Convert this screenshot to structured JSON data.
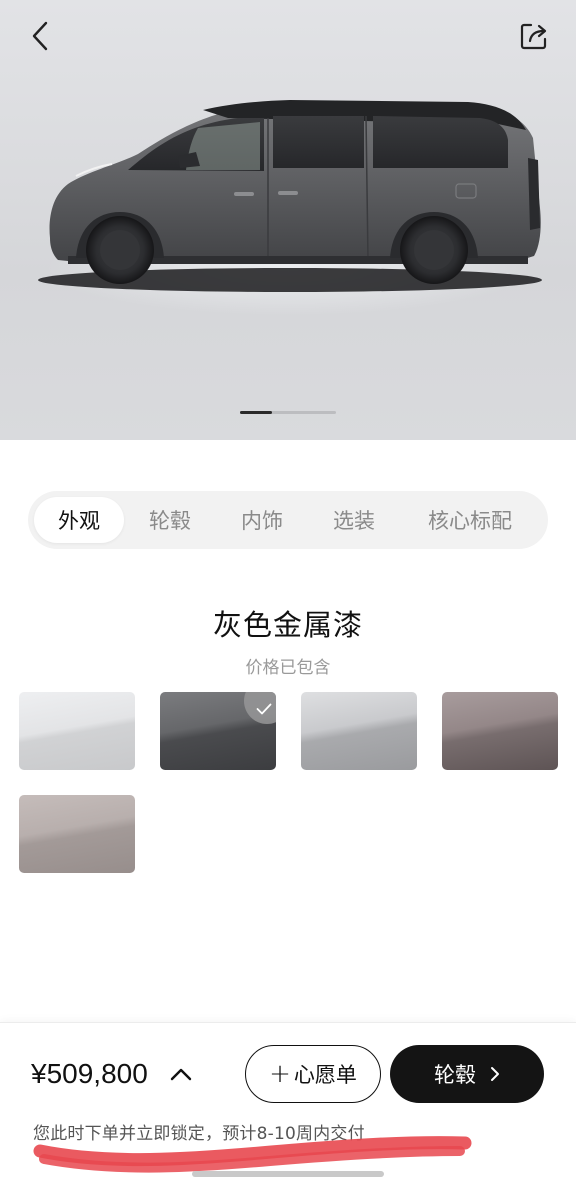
{
  "header": {
    "back_icon": "chevron-left-icon",
    "share_icon": "share-icon"
  },
  "gallery": {
    "current_page": 1,
    "total_pages": 3
  },
  "tabs": [
    {
      "label": "外观",
      "active": true
    },
    {
      "label": "轮毂",
      "active": false
    },
    {
      "label": "内饰",
      "active": false
    },
    {
      "label": "选装",
      "active": false
    },
    {
      "label": "核心标配",
      "active": false
    }
  ],
  "color_section": {
    "selected_name": "灰色金属漆",
    "price_note": "价格已包含",
    "swatches": [
      {
        "color": "#e3e4e6",
        "selected": false
      },
      {
        "color": "#5a5b5e",
        "selected": true
      },
      {
        "color": "#b8b9bc",
        "selected": false
      },
      {
        "color": "#857879",
        "selected": false
      },
      {
        "color": "#aea5a3",
        "selected": false
      }
    ]
  },
  "bottom_bar": {
    "price": "¥509,800",
    "wishlist_label": "心愿单",
    "next_label": "轮毂",
    "delivery_note": "您此时下单并立即锁定，预计8-10周内交付"
  },
  "colors": {
    "primary_button": "#141414",
    "scribble": "#e8484f"
  }
}
